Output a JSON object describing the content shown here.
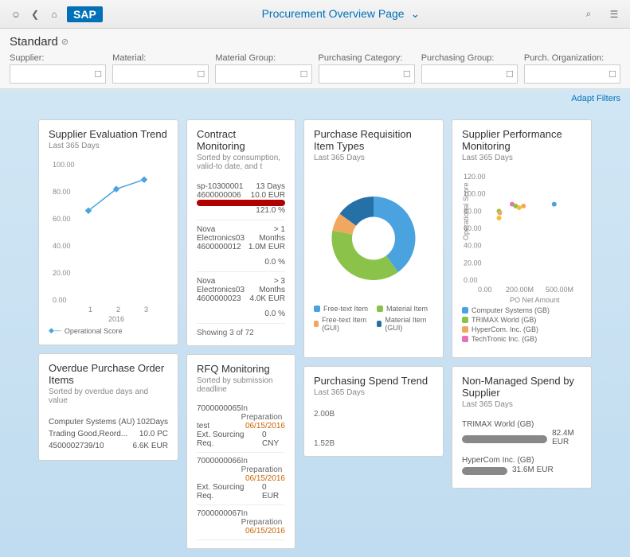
{
  "header": {
    "title": "Procurement Overview Page"
  },
  "variant": "Standard",
  "filters": [
    {
      "label": "Supplier:"
    },
    {
      "label": "Material:"
    },
    {
      "label": "Material Group:"
    },
    {
      "label": "Purchasing Category:"
    },
    {
      "label": "Purchasing Group:"
    },
    {
      "label": "Purch. Organization:"
    }
  ],
  "adapt": "Adapt Filters",
  "cards": {
    "supplier_eval": {
      "title": "Supplier Evaluation Trend",
      "sub": "Last 365 Days",
      "chart_data": {
        "type": "line",
        "x": [
          1,
          2,
          3
        ],
        "series": [
          {
            "name": "Operational Score",
            "values": [
              66,
              82,
              89
            ]
          }
        ],
        "ylim": [
          0,
          100
        ],
        "xlabel": "2016",
        "ylabel": ""
      }
    },
    "contract": {
      "title": "Contract Monitoring",
      "sub": "Sorted by consumption, valid-to date, and t",
      "items": [
        {
          "name": "sp-10300001",
          "id": "4600000006",
          "days": "13 Days",
          "amt": "10.0 EUR",
          "pct": "121.0 %",
          "pctv": 100,
          "color": "red"
        },
        {
          "name": "Nova Electronics03",
          "id": "4600000012",
          "days": "> 1 Months",
          "amt": "1.0M EUR",
          "pct": "0.0 %",
          "pctv": 0,
          "color": "grey"
        },
        {
          "name": "Nova Electronics03",
          "id": "4600000023",
          "days": "> 3 Months",
          "amt": "4.0K EUR",
          "pct": "0.0 %",
          "pctv": 0,
          "color": "grey"
        }
      ],
      "footer": "Showing 3 of 72"
    },
    "rfq": {
      "title": "RFQ Monitoring",
      "sub": "Sorted by submission deadline",
      "items": [
        {
          "id": "7000000065",
          "status": "In Preparation",
          "name": "test",
          "date": "06/15/2016",
          "req": "Ext. Sourcing Req.",
          "amt": "0 CNY"
        },
        {
          "id": "7000000066",
          "status": "In Preparation",
          "name": "",
          "date": "06/15/2016",
          "req": "Ext. Sourcing Req.",
          "amt": "0 EUR"
        },
        {
          "id": "7000000067",
          "status": "In Preparation",
          "name": "",
          "date": "06/15/2016",
          "req": "",
          "amt": ""
        }
      ]
    },
    "opo": {
      "title": "Overdue Purchase Order Items",
      "sub": "Sorted by overdue days and value",
      "items": [
        {
          "name": "Computer Systems (AU)",
          "days": "102Days",
          "mat": "Trading Good,Reord...",
          "qty": "10.0 PC",
          "id": "4500002739/10",
          "amt": "6.6K EUR"
        }
      ]
    },
    "pritem": {
      "title": "Purchase Requisition Item Types",
      "sub": "Last 365 Days",
      "chart_data": {
        "type": "pie",
        "slices": [
          {
            "name": "Free-text Item",
            "color": "#4aa3df",
            "value": 40
          },
          {
            "name": "Material Item",
            "color": "#8bc34a",
            "value": 38
          },
          {
            "name": "Free-text Item (GUI)",
            "color": "#f0a860",
            "value": 7
          },
          {
            "name": "Material Item (GUI)",
            "color": "#2670a8",
            "value": 15
          }
        ]
      }
    },
    "spend": {
      "title": "Purchasing Spend Trend",
      "sub": "Last 365 Days",
      "chart_data": {
        "type": "bar",
        "values": [
          2.0,
          1.52
        ],
        "labels": [
          "2.00B",
          "1.52B"
        ]
      }
    },
    "supperf": {
      "title": "Supplier Performance Monitoring",
      "sub": "Last 365 Days",
      "chart_data": {
        "type": "scatter",
        "ylabel": "Operational Score",
        "xlabel": "PO Net Amount",
        "ylim": [
          0,
          120
        ],
        "xticks": [
          "0.00",
          "200.00M",
          "500.00M"
        ],
        "points": [
          {
            "x": 0.15,
            "y": 80,
            "c": "#8bc34a"
          },
          {
            "x": 0.16,
            "y": 78,
            "c": "#f0a860"
          },
          {
            "x": 0.3,
            "y": 88,
            "c": "#e573b5"
          },
          {
            "x": 0.34,
            "y": 86,
            "c": "#8bc34a"
          },
          {
            "x": 0.38,
            "y": 84,
            "c": "#f0c030"
          },
          {
            "x": 0.43,
            "y": 86,
            "c": "#f0a860"
          },
          {
            "x": 0.78,
            "y": 88,
            "c": "#4aa3df"
          },
          {
            "x": 0.15,
            "y": 72,
            "c": "#f0c030"
          }
        ],
        "legend": [
          {
            "name": "Computer Systems (GB)",
            "c": "#4aa3df"
          },
          {
            "name": "TRIMAX World (GB)",
            "c": "#8bc34a"
          },
          {
            "name": "HyperCom. Inc. (GB)",
            "c": "#f0a860"
          },
          {
            "name": "TechTronic Inc. (GB)",
            "c": "#e573b5"
          }
        ]
      }
    },
    "nms": {
      "title": "Non-Managed Spend by Supplier",
      "sub": "Last 365 Days",
      "items": [
        {
          "name": "TRIMAX World (GB)",
          "amt": "82.4M EUR",
          "pct": 100
        },
        {
          "name": "HyperCom Inc. (GB)",
          "amt": "31.6M EUR",
          "pct": 38
        }
      ]
    }
  }
}
